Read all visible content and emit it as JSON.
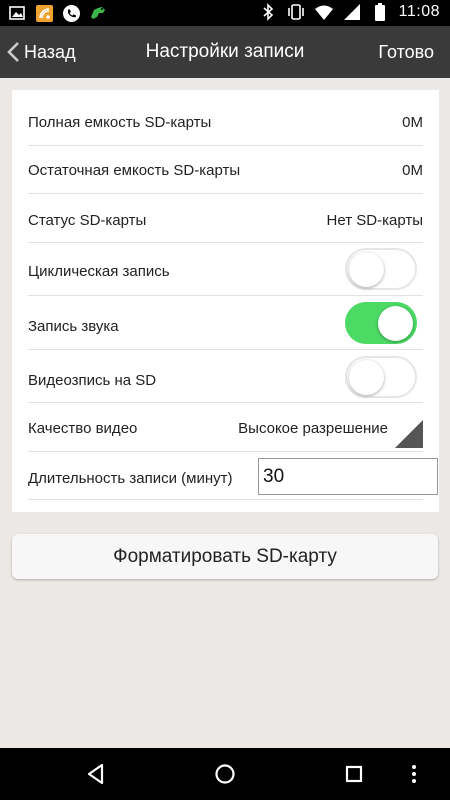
{
  "statusbar": {
    "time": "11:08",
    "left_icons": [
      "image-icon",
      "app-icon",
      "phone-icon",
      "bug-icon"
    ],
    "right_icons": [
      "bluetooth-icon",
      "vibrate-icon",
      "wifi-icon",
      "signal-icon",
      "battery-icon"
    ]
  },
  "navbar": {
    "back_label": "Назад",
    "title": "Настройки записи",
    "done_label": "Готово"
  },
  "settings": {
    "total_capacity": {
      "label": "Полная емкость SD-карты",
      "value": "0M"
    },
    "remaining_capacity": {
      "label": "Остаточная емкость SD-карты",
      "value": "0M"
    },
    "sd_status": {
      "label": "Статус SD-карты",
      "value": "Нет SD-карты"
    },
    "loop_recording": {
      "label": "Циклическая запись",
      "enabled": false
    },
    "audio_recording": {
      "label": "Запись звука",
      "enabled": true
    },
    "sd_video_recording": {
      "label": "Видеозпись на SD",
      "enabled": false
    },
    "video_quality": {
      "label": "Качество видео",
      "value": "Высокое разрешение"
    },
    "record_duration": {
      "label": "Длительность записи (минут)",
      "value": "30"
    }
  },
  "format_button_label": "Форматировать SD-карту",
  "colors": {
    "toggle_on": "#4cd964",
    "navbar_bg": "#3a3a3a",
    "page_bg": "#ebe8e5"
  }
}
